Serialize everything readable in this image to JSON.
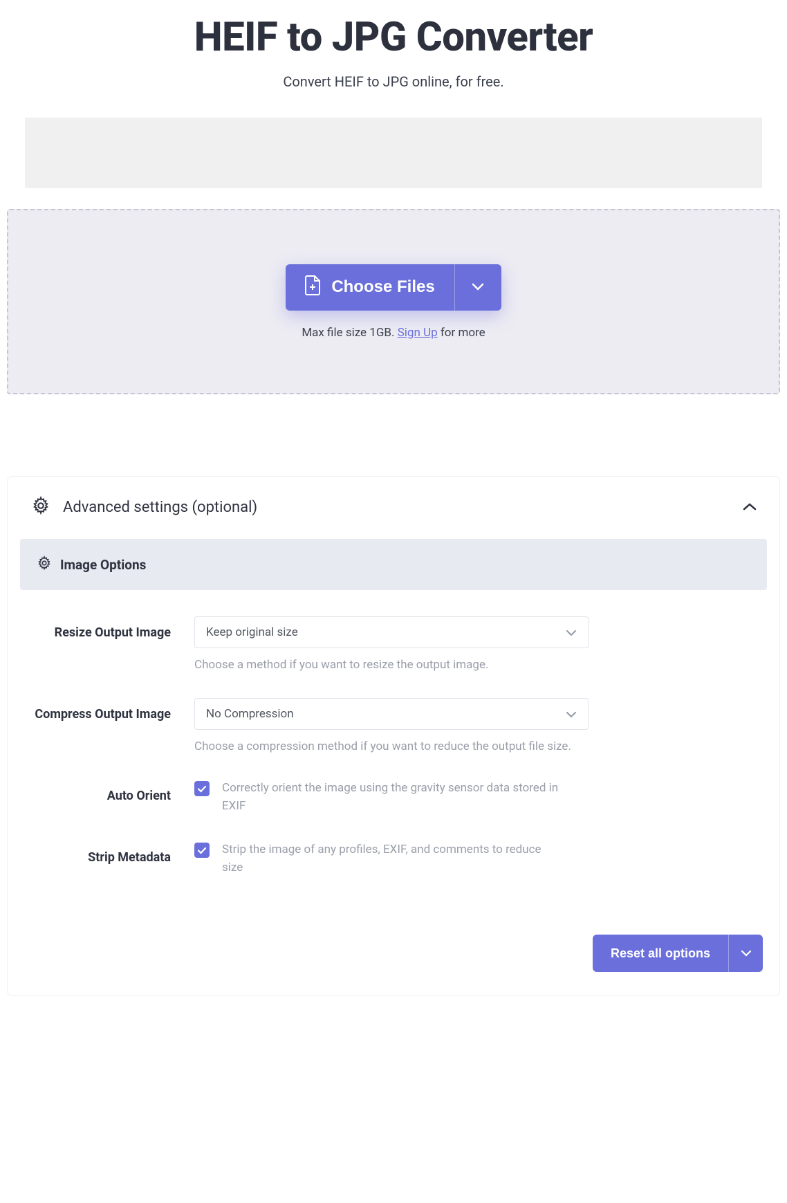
{
  "header": {
    "title": "HEIF to JPG Converter",
    "subtitle": "Convert HEIF to JPG online, for free."
  },
  "dropzone": {
    "choose_files_label": "Choose Files",
    "hint_prefix": "Max file size 1GB. ",
    "hint_link": "Sign Up",
    "hint_suffix": " for more"
  },
  "advanced": {
    "title": "Advanced settings (optional)",
    "section_title": "Image Options",
    "options": {
      "resize": {
        "label": "Resize Output Image",
        "value": "Keep original size",
        "help": "Choose a method if you want to resize the output image."
      },
      "compress": {
        "label": "Compress Output Image",
        "value": "No Compression",
        "help": "Choose a compression method if you want to reduce the output file size."
      },
      "auto_orient": {
        "label": "Auto Orient",
        "checked": true,
        "desc": "Correctly orient the image using the gravity sensor data stored in EXIF"
      },
      "strip_metadata": {
        "label": "Strip Metadata",
        "checked": true,
        "desc": "Strip the image of any profiles, EXIF, and comments to reduce size"
      }
    },
    "reset_label": "Reset all options"
  }
}
